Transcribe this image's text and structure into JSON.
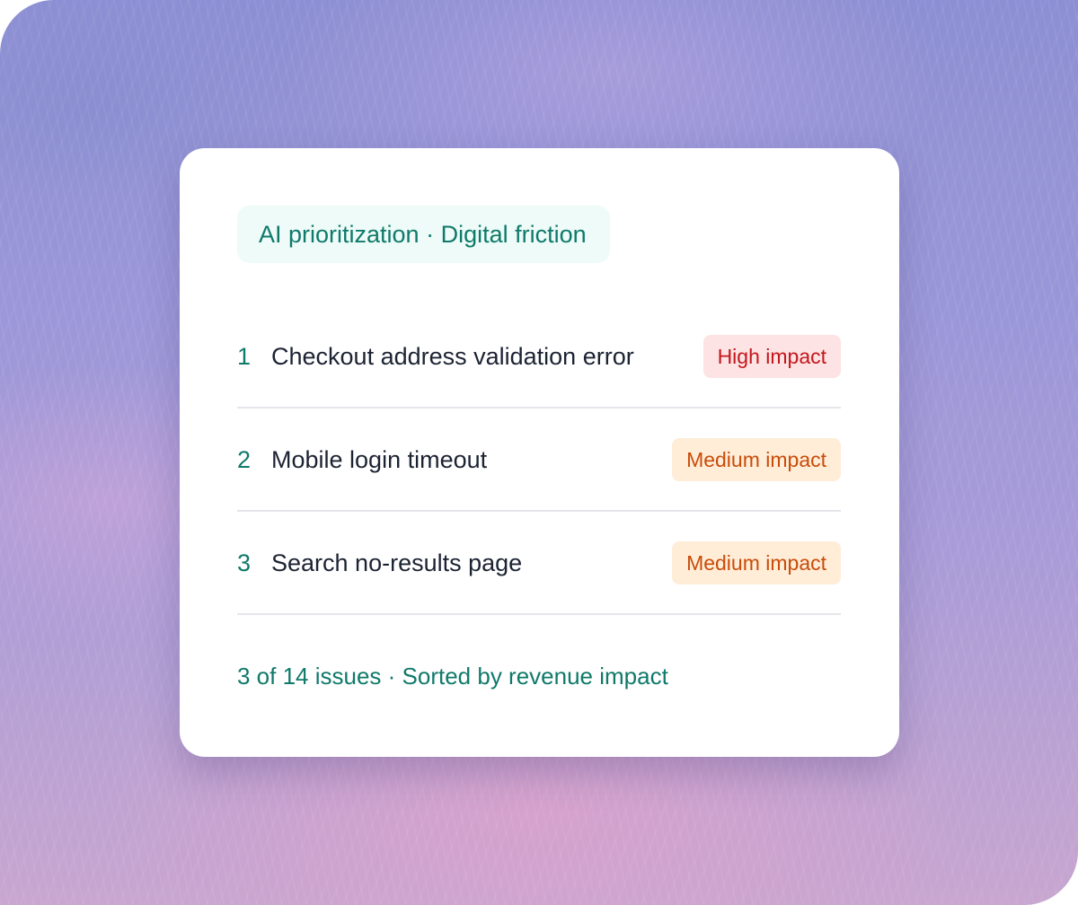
{
  "card": {
    "header": "AI prioritization · Digital friction",
    "issues": [
      {
        "rank": "1",
        "title": "Checkout address validation error",
        "impact": "High impact",
        "impact_level": "high"
      },
      {
        "rank": "2",
        "title": "Mobile login timeout",
        "impact": "Medium impact",
        "impact_level": "medium"
      },
      {
        "rank": "3",
        "title": "Search no-results page",
        "impact": "Medium impact",
        "impact_level": "medium"
      }
    ],
    "footer": "3 of 14 issues · Sorted by revenue impact"
  },
  "colors": {
    "accent": "#0f7a6a",
    "header_bg": "#eefbf8",
    "high_bg": "#fde3e3",
    "high_text": "#c5161d",
    "medium_bg": "#ffedd8",
    "medium_text": "#c94c0a",
    "title_text": "#1c2333"
  }
}
